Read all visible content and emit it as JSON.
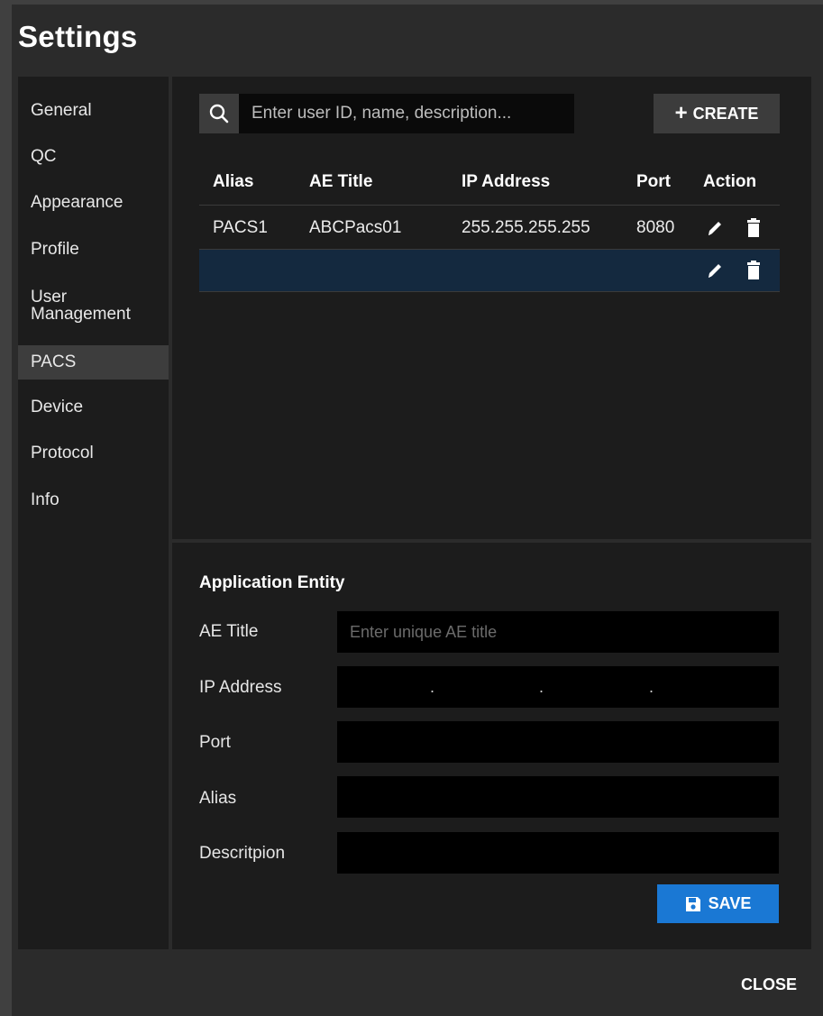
{
  "dialog": {
    "title": "Settings",
    "close_label": "CLOSE"
  },
  "sidebar": {
    "items": [
      {
        "label": "General"
      },
      {
        "label": "QC"
      },
      {
        "label": "Appearance"
      },
      {
        "label": "Profile"
      },
      {
        "label_line1": "User",
        "label_line2": "Management"
      },
      {
        "label": "PACS",
        "active": true
      },
      {
        "label": "Device"
      },
      {
        "label": "Protocol"
      },
      {
        "label": "Info"
      }
    ]
  },
  "search": {
    "placeholder": "Enter user ID, name, description...",
    "value": ""
  },
  "toolbar": {
    "create_label": "CREATE"
  },
  "table": {
    "headers": [
      "Alias",
      "AE Title",
      "IP Address",
      "Port",
      "Action"
    ],
    "rows": [
      {
        "alias": "PACS1",
        "ae_title": "ABCPacs01",
        "ip": "255.255.255.255",
        "port": "8080"
      },
      {
        "alias": "",
        "ae_title": "",
        "ip": "",
        "port": "",
        "selected": true
      }
    ]
  },
  "form": {
    "section_title": "Application Entity",
    "ae_title": {
      "label": "AE Title",
      "placeholder": "Enter unique AE title",
      "value": ""
    },
    "ip_address": {
      "label": "IP Address",
      "value": ""
    },
    "port": {
      "label": "Port",
      "value": ""
    },
    "alias": {
      "label": "Alias",
      "value": ""
    },
    "description": {
      "label": "Descritpion",
      "value": ""
    },
    "save_label": "SAVE"
  },
  "colors": {
    "accent": "#1a78d4",
    "selected_row": "#14293f",
    "panel": "#1c1c1c",
    "dialog": "#2b2b2b"
  },
  "icons": [
    "search-icon",
    "plus-icon",
    "edit-icon",
    "delete-icon",
    "save-icon"
  ]
}
